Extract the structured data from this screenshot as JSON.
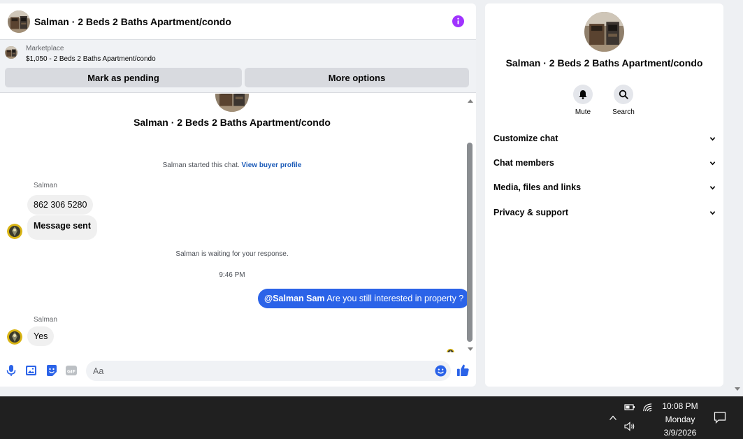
{
  "chat": {
    "title": "Salman · 2 Beds 2 Baths Apartment/condo",
    "listing": {
      "source": "Marketplace",
      "price_line": "$1,050 - 2 Beds 2 Baths Apartment/condo",
      "mark_pending_label": "Mark as pending",
      "more_options_label": "More options"
    },
    "thread_title": "Salman · 2 Beds 2 Baths Apartment/condo",
    "started_note": "Salman started this chat.",
    "view_profile_link": "View buyer profile",
    "group1_sender": "Salman",
    "msg1": "862 306 5280",
    "msg2": "Message sent",
    "waiting_note": "Salman is waiting for your response.",
    "timestamp": "9:46 PM",
    "outgoing_mention": "@Salman Sam",
    "outgoing_text": " Are you still interested in property ?",
    "group2_sender": "Salman",
    "msg3": "Yes",
    "composer_placeholder": "Aa"
  },
  "info_panel": {
    "name": "Salman · 2 Beds 2 Baths Apartment/condo",
    "actions": [
      {
        "label": "Mute",
        "icon": "bell-icon"
      },
      {
        "label": "Search",
        "icon": "search-icon"
      }
    ],
    "sections": [
      {
        "label": "Customize chat"
      },
      {
        "label": "Chat members"
      },
      {
        "label": "Media, files and links"
      },
      {
        "label": "Privacy & support"
      }
    ]
  },
  "taskbar": {
    "time": "10:08 PM",
    "day": "Monday",
    "date": "3/9/2026"
  },
  "colors": {
    "accent_blue": "#2b63e8",
    "info_purple": "#a033ff",
    "taskbar_bg": "#202020"
  }
}
